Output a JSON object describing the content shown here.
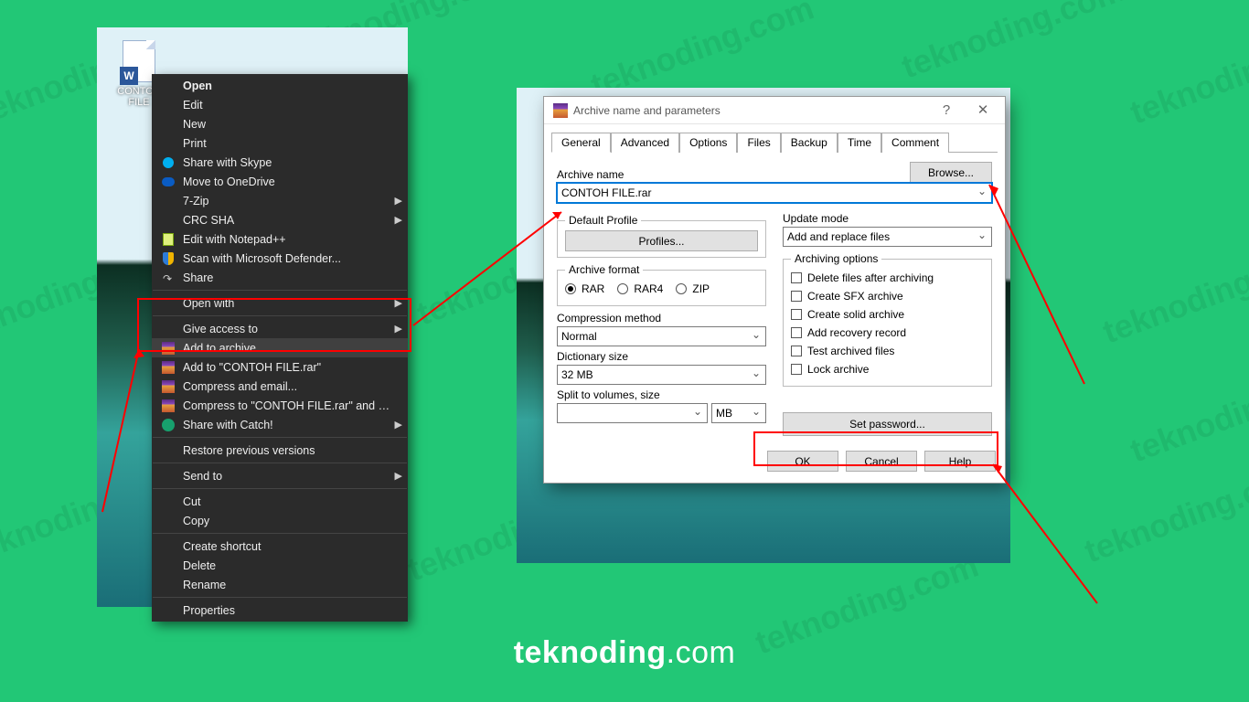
{
  "watermark": "teknoding.com",
  "caption": {
    "bold": "teknoding",
    "rest": ".com"
  },
  "desktop_icon": {
    "glyph": "W",
    "label_line1": "CONTOH",
    "label_line2": "FILE"
  },
  "context_menu": {
    "open": "Open",
    "edit": "Edit",
    "new": "New",
    "print": "Print",
    "share_skype": "Share with Skype",
    "onedrive": "Move to OneDrive",
    "sevenzip": "7-Zip",
    "crcsha": "CRC SHA",
    "notepad": "Edit with Notepad++",
    "defender": "Scan with Microsoft Defender...",
    "share": "Share",
    "open_with": "Open with",
    "give_access": "Give access to",
    "add_archive": "Add to archive...",
    "add_to_rar": "Add to \"CONTOH FILE.rar\"",
    "compress_email": "Compress and email...",
    "compress_to_email": "Compress to \"CONTOH FILE.rar\" and email",
    "share_catch": "Share with Catch!",
    "restore": "Restore previous versions",
    "send_to": "Send to",
    "cut": "Cut",
    "copy": "Copy",
    "shortcut": "Create shortcut",
    "delete": "Delete",
    "rename": "Rename",
    "properties": "Properties"
  },
  "dialog": {
    "title": "Archive name and parameters",
    "help_glyph": "?",
    "close_glyph": "✕",
    "tabs": [
      "General",
      "Advanced",
      "Options",
      "Files",
      "Backup",
      "Time",
      "Comment"
    ],
    "archive_name_label": "Archive name",
    "archive_name_value": "CONTOH FILE.rar",
    "browse": "Browse...",
    "default_profile": "Default Profile",
    "profiles_btn": "Profiles...",
    "update_mode_label": "Update mode",
    "update_mode_value": "Add and replace files",
    "archive_format_label": "Archive format",
    "fmt_rar": "RAR",
    "fmt_rar4": "RAR4",
    "fmt_zip": "ZIP",
    "compression_label": "Compression method",
    "compression_value": "Normal",
    "dict_label": "Dictionary size",
    "dict_value": "32 MB",
    "split_label": "Split to volumes, size",
    "split_value": "",
    "split_unit": "MB",
    "arch_opts_label": "Archiving options",
    "opt_delete": "Delete files after archiving",
    "opt_sfx": "Create SFX archive",
    "opt_solid": "Create solid archive",
    "opt_recovery": "Add recovery record",
    "opt_test": "Test archived files",
    "opt_lock": "Lock archive",
    "set_password": "Set password...",
    "ok": "OK",
    "cancel": "Cancel",
    "help": "Help"
  }
}
